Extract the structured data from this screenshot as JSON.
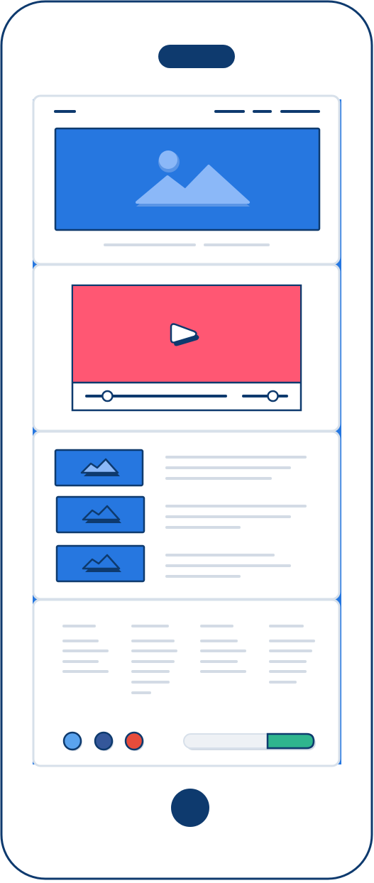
{
  "colors": {
    "outline": "#0e3a6e",
    "accent_blue": "#2677e0",
    "image_light": "#8bb8f8",
    "image_shadow": "#5a95e6",
    "video_red": "#ff5773",
    "light_gray": "#d3dbe5",
    "panel_border": "#d7e0ea",
    "panel_fill": "#ffffff",
    "dot_light_blue": "#5aa3ee",
    "dot_navy": "#34579a",
    "dot_red": "#e74c3c",
    "search_green": "#2fb58e",
    "search_track": "#eef1f5"
  },
  "icons": {
    "speaker": "speaker-icon",
    "home_button": "home-button-icon",
    "hero_image": "mountain-image-icon",
    "video_play": "play-icon",
    "thumbnails": "mountain-thumbnail-icon"
  },
  "video": {
    "progress_fraction": 0.15,
    "volume_fraction": 0.68
  },
  "article_list": {
    "count": 3
  },
  "footer": {
    "column_count": 4,
    "dots": [
      "light-blue",
      "navy",
      "red"
    ]
  }
}
